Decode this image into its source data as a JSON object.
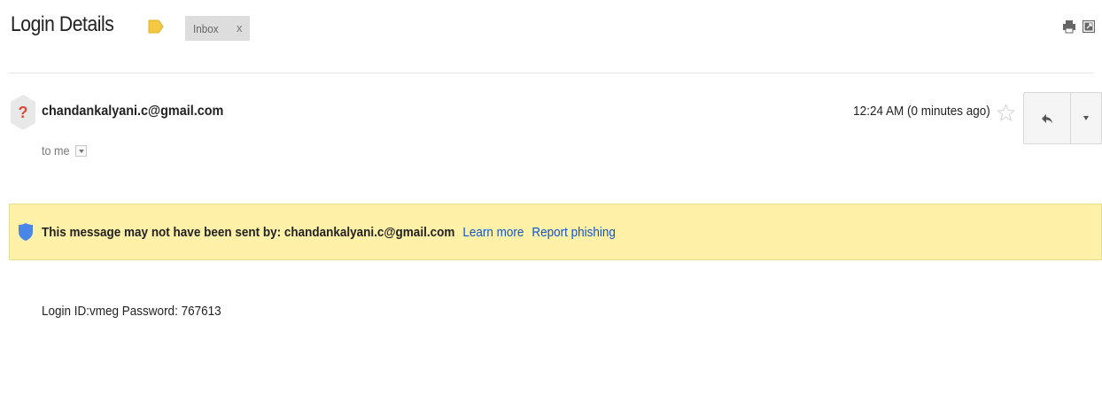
{
  "header": {
    "subject": "Login Details",
    "label": "Inbox",
    "label_remove": "x",
    "icons": [
      "print-icon",
      "open-in-new-window-icon"
    ]
  },
  "message": {
    "sender": "chandankalyani.c@gmail.com",
    "recipients": "to me",
    "timestamp": "12:24 AM (0 minutes ago)",
    "avatar_icon": "unknown-sender-icon",
    "body": "Login ID:vmeg Password: 767613"
  },
  "warning": {
    "message": "This message may not have been sent by: chandankalyani.c@gmail.com",
    "learn_more": "Learn more",
    "report_phishing": "Report phishing",
    "icon": "shield-icon"
  },
  "colors": {
    "warning_bg": "#fff1a8",
    "link": "#1155cc",
    "important_marker": "#f4c842",
    "question_mark": "#dd4b39"
  }
}
